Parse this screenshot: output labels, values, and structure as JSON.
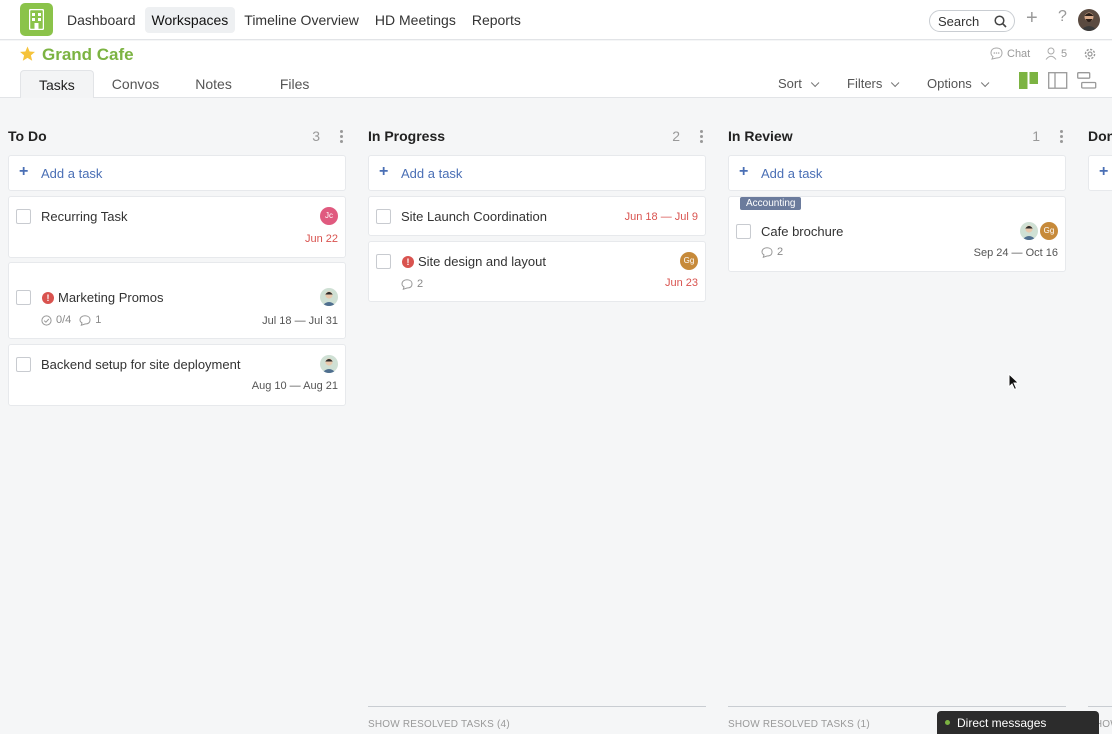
{
  "nav": {
    "items": [
      "Dashboard",
      "Workspaces",
      "Timeline Overview",
      "HD Meetings",
      "Reports"
    ],
    "active": "Workspaces",
    "search_placeholder": "Search"
  },
  "workspace": {
    "title": "Grand Cafe",
    "chat_label": "Chat",
    "member_count": "5",
    "tabs": [
      "Tasks",
      "Convos",
      "Notes",
      "Files"
    ],
    "active_tab": "Tasks",
    "sort_label": "Sort",
    "filters_label": "Filters",
    "options_label": "Options"
  },
  "columns": [
    {
      "title": "To Do",
      "count": "3",
      "add_label": "Add a task",
      "cards": [
        {
          "title": "Recurring Task",
          "date": "Jun 22",
          "avatar": "Jc"
        },
        {
          "tag": "urgent",
          "title": "Marketing Promos",
          "checklist": "0/4",
          "comments": "1",
          "date": "Jul 18 — Jul 31"
        },
        {
          "title": "Backend setup for site deployment",
          "date": "Aug 10 — Aug 21"
        }
      ]
    },
    {
      "title": "In Progress",
      "count": "2",
      "add_label": "Add a task",
      "resolved": "SHOW RESOLVED TASKS (4)",
      "cards": [
        {
          "title": "Site Launch Coordination",
          "date": "Jun 18 — Jul 9"
        },
        {
          "title": "Site design and layout",
          "comments": "2",
          "date": "Jun 23",
          "avatar": "Gg"
        }
      ]
    },
    {
      "title": "In Review",
      "count": "1",
      "add_label": "Add a task",
      "resolved": "SHOW RESOLVED TASKS (1)",
      "cards": [
        {
          "tag": "Accounting",
          "title": "Cafe brochure",
          "comments": "2",
          "date": "Sep 24 — Oct 16",
          "avatar": "Gg"
        }
      ]
    },
    {
      "title": "Done",
      "resolved": "SHOW"
    }
  ],
  "direct_messages": "Direct messages",
  "colors": {
    "brand": "#7cb342",
    "accent": "#4a6fb5",
    "danger": "#d9534f"
  }
}
